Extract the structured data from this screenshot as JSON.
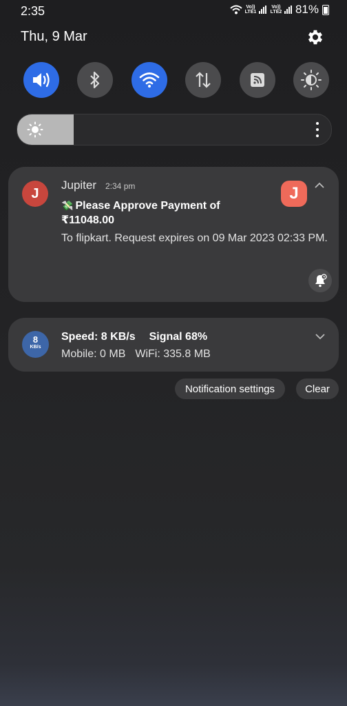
{
  "status_bar": {
    "time": "2:35",
    "sim1_label": "Vo)) LTE1",
    "sim2_label": "Vo)) LTE2",
    "battery": "81%"
  },
  "header": {
    "date": "Thu, 9 Mar",
    "settings_icon": "gear-icon"
  },
  "quick_toggles": [
    {
      "name": "sound",
      "icon": "speaker-icon",
      "on": true
    },
    {
      "name": "bluetooth",
      "icon": "bluetooth-icon",
      "on": false
    },
    {
      "name": "wifi",
      "icon": "wifi-icon",
      "on": true
    },
    {
      "name": "mobile-data",
      "icon": "data-arrows-icon",
      "on": false
    },
    {
      "name": "nfc",
      "icon": "nfc-icon",
      "on": false
    },
    {
      "name": "eye-comfort",
      "icon": "eye-comfort-icon",
      "on": false
    }
  ],
  "brightness": {
    "level_fraction": 0.18
  },
  "notification": {
    "app_initial": "J",
    "app_name": "Jupiter",
    "time": "2:34 pm",
    "title_emoji": "💸",
    "title": "Please Approve Payment of ₹11048.00",
    "body": "To flipkart. Request expires on 09 Mar 2023 02:33 PM."
  },
  "speed_notification": {
    "icon_value": "8",
    "icon_unit": "KB/s",
    "speed": "Speed: 8 KB/s",
    "signal": "Signal 68%",
    "mobile": "Mobile: 0 MB",
    "wifi": "WiFi: 335.8 MB"
  },
  "actions": {
    "notification_settings": "Notification settings",
    "clear": "Clear"
  },
  "colors": {
    "accent": "#2e6ce6",
    "app_icon": "#c8463d",
    "app_large_icon": "#ef6a5a",
    "speed_icon": "#3d66a8"
  }
}
